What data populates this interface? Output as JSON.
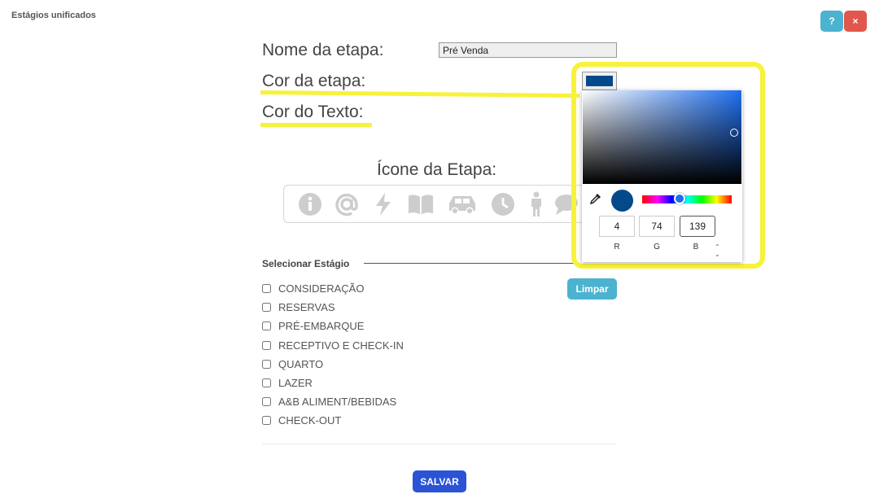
{
  "page": {
    "heading": "Estágios unificados"
  },
  "toolbar": {
    "help_label": "?",
    "close_label": "×"
  },
  "form": {
    "name_label": "Nome da etapa:",
    "name_value": "Pré Venda",
    "stage_color_label": "Cor da etapa:",
    "text_color_label": "Cor do Texto:",
    "icon_label": "Ícone da Etapa:"
  },
  "icons": [
    "info-icon",
    "at-sign-icon",
    "bolt-icon",
    "book-icon",
    "car-icon",
    "clock-icon",
    "person-icon",
    "comment-icon"
  ],
  "stages": {
    "section_title": "Selecionar Estágio",
    "clear_label": "Limpar",
    "items": [
      "CONSIDERAÇÃO",
      "RESERVAS",
      "PRÉ-EMBARQUE",
      "RECEPTIVO E CHECK-IN",
      "QUARTO",
      "LAZER",
      "A&B ALIMENT/BEBIDAS",
      "CHECK-OUT"
    ]
  },
  "save_label": "SALVAR",
  "color_picker": {
    "selected_color": "#044a8b",
    "r": "4",
    "g": "74",
    "b": "139",
    "r_label": "R",
    "g_label": "G",
    "b_label": "B",
    "hue_color": "#1e6ff0"
  },
  "colors": {
    "highlight": "#f7f23a",
    "accent": "#4bb3cf",
    "danger": "#e2574c",
    "primary": "#2a53d6",
    "icon_gray": "#cdcdcd"
  }
}
